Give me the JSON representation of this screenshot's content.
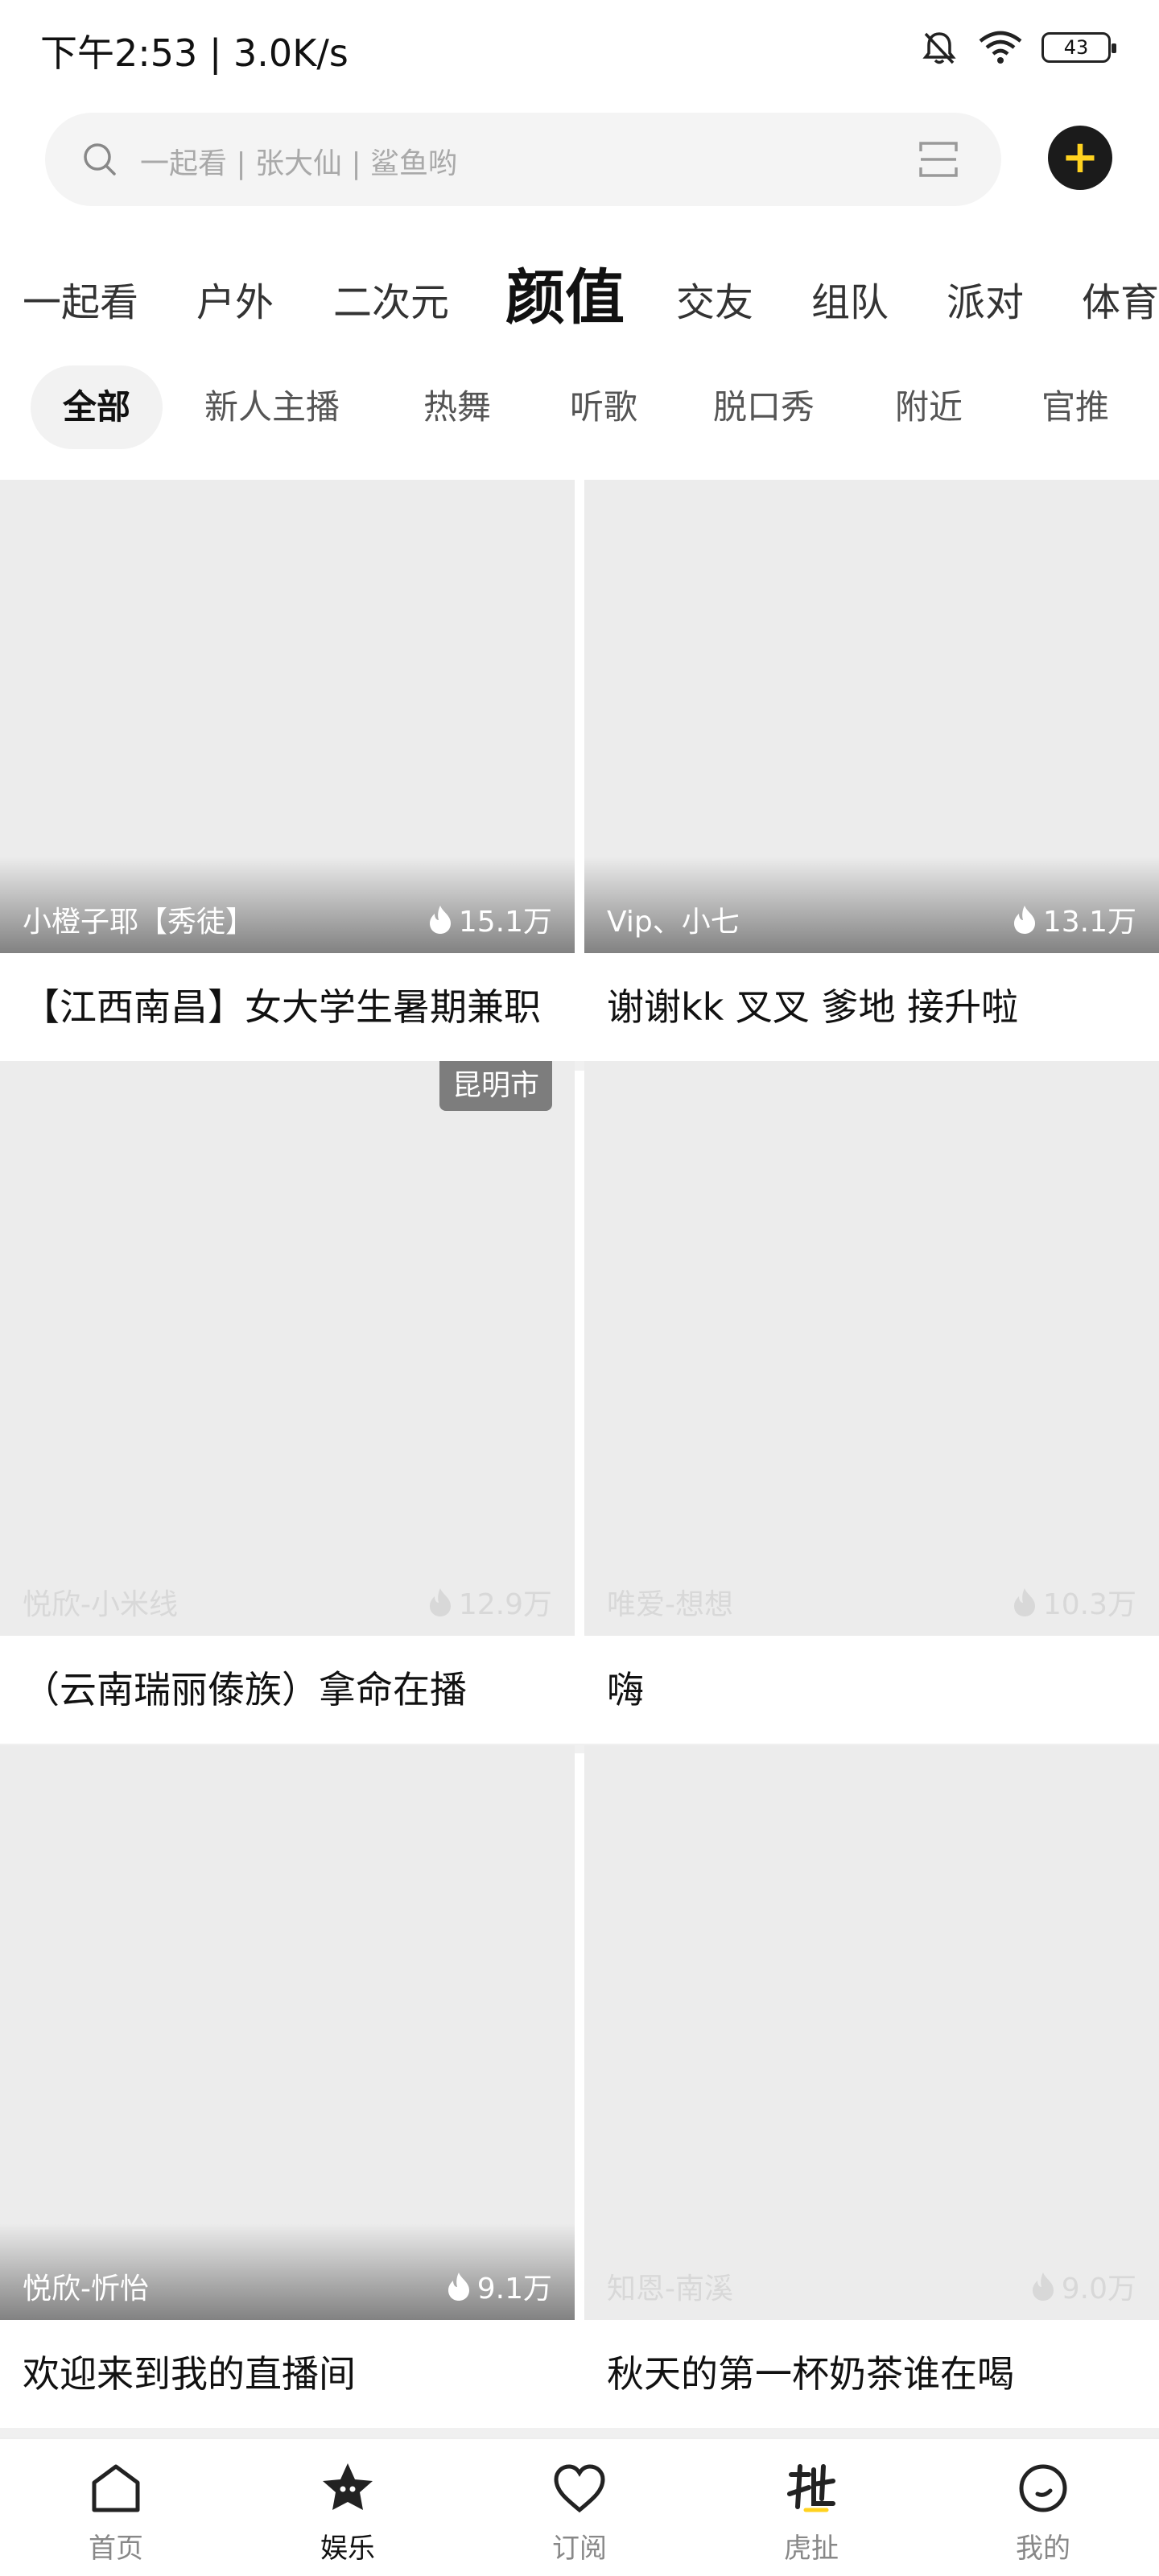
{
  "status_bar": {
    "time": "下午2:53 | 3.0K/s",
    "battery": "43"
  },
  "search": {
    "placeholder": "一起看 | 张大仙 | 鲨鱼哟",
    "add_label": "+"
  },
  "category_tabs": [
    {
      "label": "一起看"
    },
    {
      "label": "户外"
    },
    {
      "label": "二次元"
    },
    {
      "label": "颜值",
      "active": true
    },
    {
      "label": "交友"
    },
    {
      "label": "组队"
    },
    {
      "label": "派对"
    },
    {
      "label": "体育"
    }
  ],
  "sub_tabs": [
    {
      "label": "全部",
      "active": true
    },
    {
      "label": "新人主播"
    },
    {
      "label": "热舞"
    },
    {
      "label": "听歌"
    },
    {
      "label": "脱口秀"
    },
    {
      "label": "附近"
    },
    {
      "label": "官推"
    }
  ],
  "cards": [
    {
      "anchor": "小橙子耶【秀徒】",
      "heat": "15.1万",
      "title": "【江西南昌】女大学生暑期兼职"
    },
    {
      "anchor": "Vip、小七",
      "heat": "13.1万",
      "title": "谢谢kk 叉叉 爹地 接升啦"
    },
    {
      "anchor": "悦欣-小米线",
      "heat": "12.9万",
      "title": "（云南瑞丽傣族）拿命在播",
      "location": "昆明市"
    },
    {
      "anchor": "唯爱-想想",
      "heat": "10.3万",
      "title": "嗨"
    },
    {
      "anchor": "悦欣-忻怡",
      "heat": "9.1万",
      "title": "欢迎来到我的直播间"
    },
    {
      "anchor": "知恩-南溪",
      "heat": "9.0万",
      "title": "秋天的第一杯奶茶谁在喝"
    }
  ],
  "bottom_nav": [
    {
      "label": "首页",
      "icon": "home-icon"
    },
    {
      "label": "娱乐",
      "icon": "entertainment-icon",
      "active": true
    },
    {
      "label": "订阅",
      "icon": "heart-icon"
    },
    {
      "label": "虎扯",
      "icon": "huche-icon"
    },
    {
      "label": "我的",
      "icon": "profile-icon"
    }
  ],
  "colors": {
    "accent": "#ffd21f",
    "card_placeholder": "#ececec"
  }
}
